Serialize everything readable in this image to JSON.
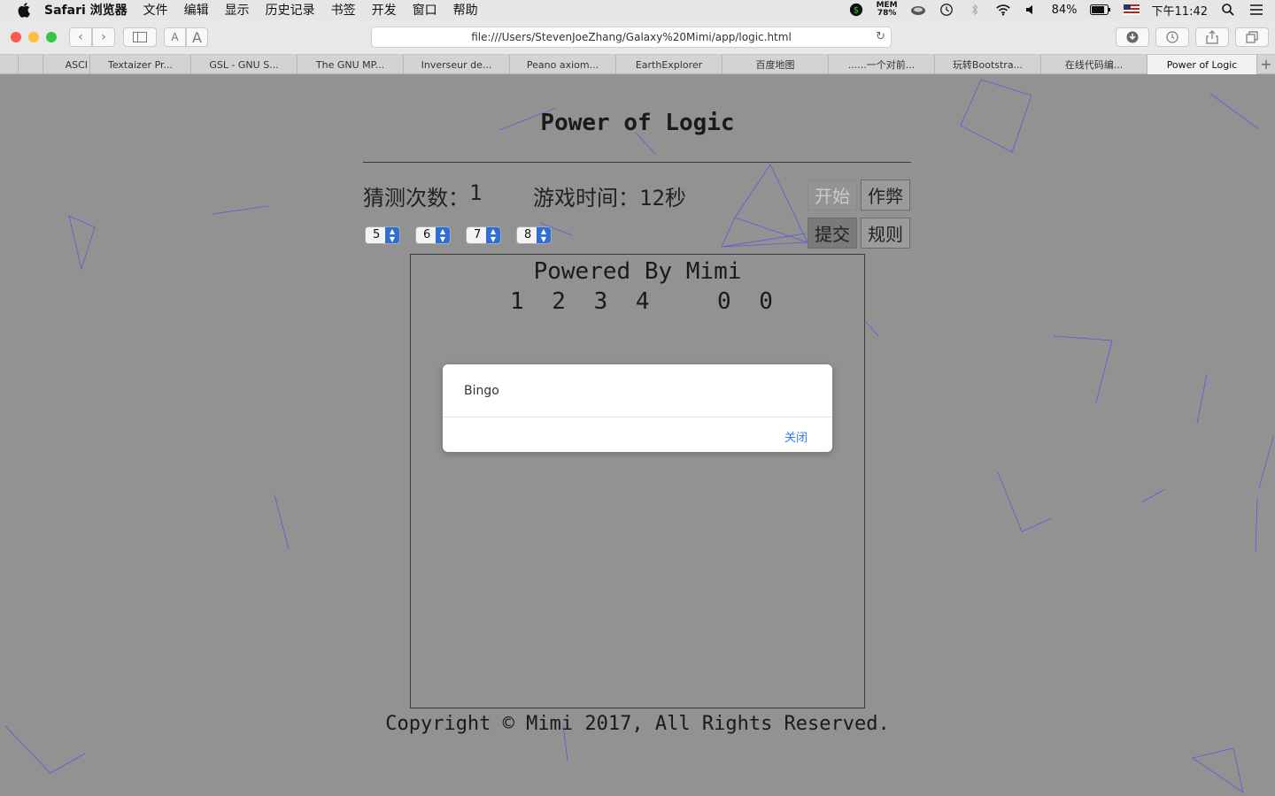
{
  "menubar": {
    "app_name": "Safari 浏览器",
    "menus": [
      "文件",
      "编辑",
      "显示",
      "历史记录",
      "书签",
      "开发",
      "窗口",
      "帮助"
    ],
    "mem_label": "MEM",
    "mem_value": "78%",
    "battery": "84%",
    "clock": "下午11:42"
  },
  "browser": {
    "url": "file:///Users/StevenJoeZhang/Galaxy%20Mimi/app/logic.html",
    "tabs": [
      "ASCI",
      "Textaizer Pr...",
      "GSL - GNU S...",
      "The GNU MP...",
      "Inverseur de...",
      "Peano axiom...",
      "EarthExplorer",
      "百度地图",
      "......一个对前...",
      "玩转Bootstra...",
      "在线代码编...",
      "Power of Logic"
    ],
    "active_tab": "Power of Logic"
  },
  "game": {
    "title": "Power of Logic",
    "guess_count_label": "猜测次数：",
    "guess_count": "1",
    "time_label": "游戏时间：",
    "time_value": "12秒",
    "selects": [
      "5",
      "6",
      "7",
      "8"
    ],
    "buttons": {
      "start": "开始",
      "cheat": "作弊",
      "submit": "提交",
      "rules": "规则"
    },
    "board_title": "Powered By Mimi",
    "history": [
      {
        "guess": "1 2 3 4",
        "result": "0 0"
      }
    ],
    "copyright": "Copyright © Mimi 2017, All Rights Reserved."
  },
  "dialog": {
    "message": "Bingo",
    "close_label": "关闭"
  },
  "colors": {
    "page_bg": "#929292",
    "link_blue": "#3478f6",
    "line_color": "#5050d0"
  }
}
